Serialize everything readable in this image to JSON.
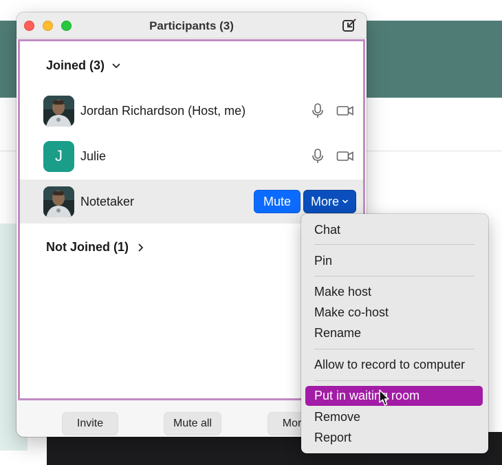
{
  "window": {
    "title": "Participants (3)"
  },
  "sections": {
    "joined_label": "Joined (3)",
    "not_joined_label": "Not Joined (1)"
  },
  "participants": [
    {
      "name": "Jordan Richardson (Host, me)",
      "avatar": "photo"
    },
    {
      "name": "Julie",
      "avatar_initial": "J",
      "avatar_color": "#1a9e8a"
    },
    {
      "name": "Notetaker",
      "avatar": "photo"
    }
  ],
  "row_actions": {
    "mute_label": "Mute",
    "more_label": "More"
  },
  "footer": {
    "invite_label": "Invite",
    "mute_all_label": "Mute all",
    "more_label": "More"
  },
  "context_menu": {
    "items": [
      {
        "label": "Chat"
      },
      {
        "label": "Pin"
      },
      {
        "label": "Make host"
      },
      {
        "label": "Make co-host"
      },
      {
        "label": "Rename"
      },
      {
        "label": "Allow to record to computer"
      },
      {
        "label": "Put in waiting room",
        "highlighted": true
      },
      {
        "label": "Remove"
      },
      {
        "label": "Report"
      }
    ]
  },
  "colors": {
    "accent_blue": "#0b6bff",
    "menu_highlight": "#a21ca6",
    "panel_border": "#c18bc3",
    "app_teal": "#4f7d75"
  }
}
